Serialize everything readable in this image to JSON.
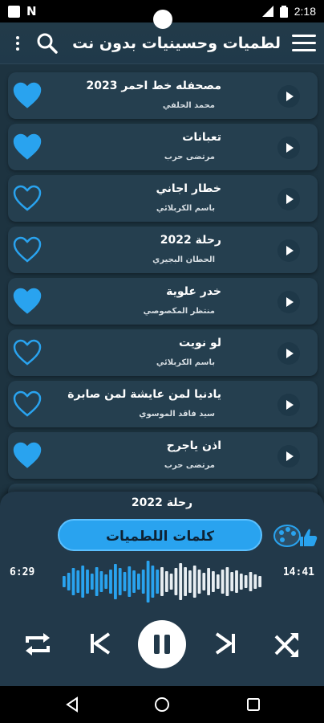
{
  "status": {
    "time": "2:18"
  },
  "app_bar": {
    "title": "لطميات وحسينيات بدون نت"
  },
  "tracks": [
    {
      "title": "مصحفله خط احمر 2023",
      "artist": "محمد الحلفي",
      "favorite": true
    },
    {
      "title": "تعبانات",
      "artist": "مرتضى حرب",
      "favorite": true
    },
    {
      "title": "خطار اجاني",
      "artist": "باسم الكربلائي",
      "favorite": false
    },
    {
      "title": "رحلة 2022",
      "artist": "الحطان البجيري",
      "favorite": false
    },
    {
      "title": "خدر علوية",
      "artist": "منتظر المكصوصي",
      "favorite": true
    },
    {
      "title": "لو نويت",
      "artist": "باسم الكربلائي",
      "favorite": false
    },
    {
      "title": "يادنيا لمن عايشة لمن صابرة",
      "artist": "سيد فاقد الموسوي",
      "favorite": false
    },
    {
      "title": "اذن ياجرح",
      "artist": "مرتضى حرب",
      "favorite": true
    }
  ],
  "player": {
    "now_playing": "رحلة 2022",
    "lyrics_label": "كلمات اللطميات",
    "elapsed": "6:29",
    "duration": "14:41"
  },
  "colors": {
    "accent": "#29a3ef",
    "background": "#1d3340",
    "card": "#253f4f"
  }
}
